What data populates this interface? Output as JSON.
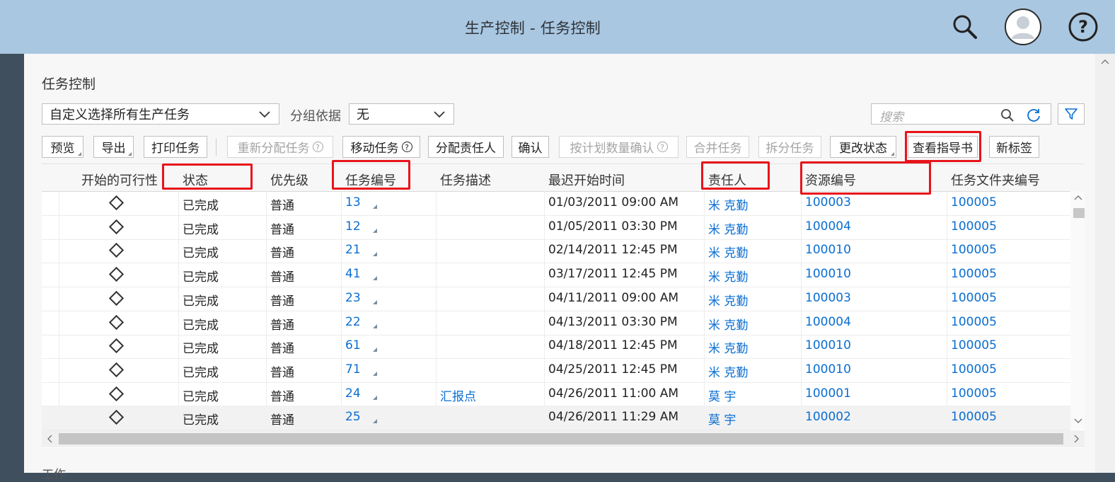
{
  "app": {
    "title": "生产控制 - 任务控制",
    "page_title": "任务控制"
  },
  "filters": {
    "variant_select": "自定义选择所有生产任务",
    "group_label": "分组依据",
    "group_select": "无",
    "search_placeholder": "搜索"
  },
  "toolbar": {
    "preview": "预览",
    "export": "导出",
    "print_task": "打印任务",
    "reassign_task": "重新分配任务",
    "move_task": "移动任务",
    "assign_responsible": "分配责任人",
    "confirm": "确认",
    "confirm_planned_qty": "按计划数量确认",
    "merge_task": "合并任务",
    "split_task": "拆分任务",
    "change_status": "更改状态",
    "view_guide": "查看指导书",
    "new_tag": "新标签",
    "help_glyph": "?"
  },
  "table": {
    "columns": [
      "开始的可行性",
      "状态",
      "优先级",
      "任务编号",
      "任务描述",
      "最迟开始时间",
      "责任人",
      "资源编号",
      "任务文件夹编号"
    ],
    "rows": [
      {
        "status": "已完成",
        "priority": "普通",
        "task_no": "13",
        "desc": "",
        "latest_start": "01/03/2011 09:00 AM",
        "responsible": "米 克勤",
        "resource": "100003",
        "folder": "100005"
      },
      {
        "status": "已完成",
        "priority": "普通",
        "task_no": "12",
        "desc": "",
        "latest_start": "01/05/2011 03:30 PM",
        "responsible": "米 克勤",
        "resource": "100004",
        "folder": "100005"
      },
      {
        "status": "已完成",
        "priority": "普通",
        "task_no": "21",
        "desc": "",
        "latest_start": "02/14/2011 12:45 PM",
        "responsible": "米 克勤",
        "resource": "100010",
        "folder": "100005"
      },
      {
        "status": "已完成",
        "priority": "普通",
        "task_no": "41",
        "desc": "",
        "latest_start": "03/17/2011 12:45 PM",
        "responsible": "米 克勤",
        "resource": "100010",
        "folder": "100005"
      },
      {
        "status": "已完成",
        "priority": "普通",
        "task_no": "23",
        "desc": "",
        "latest_start": "04/11/2011 09:00 AM",
        "responsible": "米 克勤",
        "resource": "100003",
        "folder": "100005"
      },
      {
        "status": "已完成",
        "priority": "普通",
        "task_no": "22",
        "desc": "",
        "latest_start": "04/13/2011 03:30 PM",
        "responsible": "米 克勤",
        "resource": "100004",
        "folder": "100005"
      },
      {
        "status": "已完成",
        "priority": "普通",
        "task_no": "61",
        "desc": "",
        "latest_start": "04/18/2011 12:45 PM",
        "responsible": "米 克勤",
        "resource": "100010",
        "folder": "100005"
      },
      {
        "status": "已完成",
        "priority": "普通",
        "task_no": "71",
        "desc": "",
        "latest_start": "04/25/2011 12:45 PM",
        "responsible": "米 克勤",
        "resource": "100010",
        "folder": "100005"
      },
      {
        "status": "已完成",
        "priority": "普通",
        "task_no": "24",
        "desc": "汇报点",
        "latest_start": "04/26/2011 11:00 AM",
        "responsible": "莫 宇",
        "resource": "100001",
        "folder": "100005"
      },
      {
        "status": "已完成",
        "priority": "普通",
        "task_no": "25",
        "desc": "",
        "latest_start": "04/26/2011 11:29 AM",
        "responsible": "莫 宇",
        "resource": "100002",
        "folder": "100005"
      }
    ]
  },
  "footer": {
    "partial_text": "工作"
  },
  "colors": {
    "shell": "#a9c7e1",
    "link": "#0a6ed1",
    "highlight": "#e8141b"
  },
  "icons": {
    "search": "search-icon",
    "avatar": "user-avatar-icon",
    "help": "help-icon",
    "filter": "filter-icon",
    "refresh": "refresh-icon",
    "chevron": "chevron-down-icon",
    "feasibility": "diamond-icon"
  }
}
